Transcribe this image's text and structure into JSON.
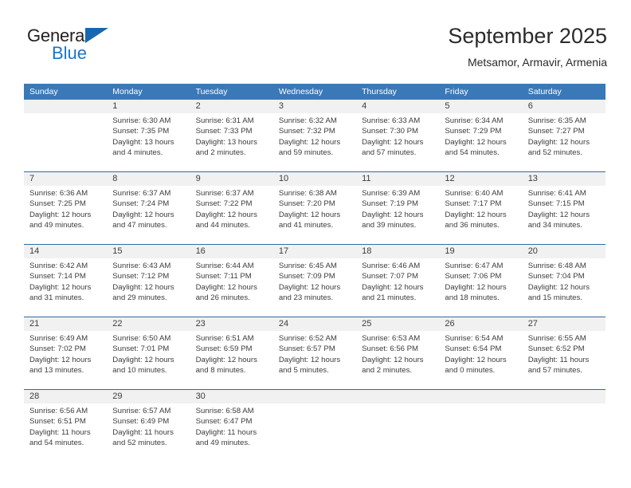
{
  "logo": {
    "word_one": "General",
    "word_two": "Blue",
    "triangle_color": "#1667b2",
    "blue_color": "#1a75c7"
  },
  "header": {
    "title": "September 2025",
    "subtitle": "Metsamor, Armavir, Armenia"
  },
  "theme": {
    "header_blue": "#3a79b8",
    "separator_blue": "#2d6ca8",
    "date_strip_gray": "#f1f1f1",
    "text_color": "#3c3c3c"
  },
  "weekdays": [
    "Sunday",
    "Monday",
    "Tuesday",
    "Wednesday",
    "Thursday",
    "Friday",
    "Saturday"
  ],
  "weeks": [
    {
      "days": [
        {
          "num": "",
          "sunrise": "",
          "sunset": "",
          "daylight1": "",
          "daylight2": "",
          "blank": true
        },
        {
          "num": "1",
          "sunrise": "Sunrise: 6:30 AM",
          "sunset": "Sunset: 7:35 PM",
          "daylight1": "Daylight: 13 hours",
          "daylight2": "and 4 minutes."
        },
        {
          "num": "2",
          "sunrise": "Sunrise: 6:31 AM",
          "sunset": "Sunset: 7:33 PM",
          "daylight1": "Daylight: 13 hours",
          "daylight2": "and 2 minutes."
        },
        {
          "num": "3",
          "sunrise": "Sunrise: 6:32 AM",
          "sunset": "Sunset: 7:32 PM",
          "daylight1": "Daylight: 12 hours",
          "daylight2": "and 59 minutes."
        },
        {
          "num": "4",
          "sunrise": "Sunrise: 6:33 AM",
          "sunset": "Sunset: 7:30 PM",
          "daylight1": "Daylight: 12 hours",
          "daylight2": "and 57 minutes."
        },
        {
          "num": "5",
          "sunrise": "Sunrise: 6:34 AM",
          "sunset": "Sunset: 7:29 PM",
          "daylight1": "Daylight: 12 hours",
          "daylight2": "and 54 minutes."
        },
        {
          "num": "6",
          "sunrise": "Sunrise: 6:35 AM",
          "sunset": "Sunset: 7:27 PM",
          "daylight1": "Daylight: 12 hours",
          "daylight2": "and 52 minutes."
        }
      ]
    },
    {
      "days": [
        {
          "num": "7",
          "sunrise": "Sunrise: 6:36 AM",
          "sunset": "Sunset: 7:25 PM",
          "daylight1": "Daylight: 12 hours",
          "daylight2": "and 49 minutes."
        },
        {
          "num": "8",
          "sunrise": "Sunrise: 6:37 AM",
          "sunset": "Sunset: 7:24 PM",
          "daylight1": "Daylight: 12 hours",
          "daylight2": "and 47 minutes."
        },
        {
          "num": "9",
          "sunrise": "Sunrise: 6:37 AM",
          "sunset": "Sunset: 7:22 PM",
          "daylight1": "Daylight: 12 hours",
          "daylight2": "and 44 minutes."
        },
        {
          "num": "10",
          "sunrise": "Sunrise: 6:38 AM",
          "sunset": "Sunset: 7:20 PM",
          "daylight1": "Daylight: 12 hours",
          "daylight2": "and 41 minutes."
        },
        {
          "num": "11",
          "sunrise": "Sunrise: 6:39 AM",
          "sunset": "Sunset: 7:19 PM",
          "daylight1": "Daylight: 12 hours",
          "daylight2": "and 39 minutes."
        },
        {
          "num": "12",
          "sunrise": "Sunrise: 6:40 AM",
          "sunset": "Sunset: 7:17 PM",
          "daylight1": "Daylight: 12 hours",
          "daylight2": "and 36 minutes."
        },
        {
          "num": "13",
          "sunrise": "Sunrise: 6:41 AM",
          "sunset": "Sunset: 7:15 PM",
          "daylight1": "Daylight: 12 hours",
          "daylight2": "and 34 minutes."
        }
      ]
    },
    {
      "days": [
        {
          "num": "14",
          "sunrise": "Sunrise: 6:42 AM",
          "sunset": "Sunset: 7:14 PM",
          "daylight1": "Daylight: 12 hours",
          "daylight2": "and 31 minutes."
        },
        {
          "num": "15",
          "sunrise": "Sunrise: 6:43 AM",
          "sunset": "Sunset: 7:12 PM",
          "daylight1": "Daylight: 12 hours",
          "daylight2": "and 29 minutes."
        },
        {
          "num": "16",
          "sunrise": "Sunrise: 6:44 AM",
          "sunset": "Sunset: 7:11 PM",
          "daylight1": "Daylight: 12 hours",
          "daylight2": "and 26 minutes."
        },
        {
          "num": "17",
          "sunrise": "Sunrise: 6:45 AM",
          "sunset": "Sunset: 7:09 PM",
          "daylight1": "Daylight: 12 hours",
          "daylight2": "and 23 minutes."
        },
        {
          "num": "18",
          "sunrise": "Sunrise: 6:46 AM",
          "sunset": "Sunset: 7:07 PM",
          "daylight1": "Daylight: 12 hours",
          "daylight2": "and 21 minutes."
        },
        {
          "num": "19",
          "sunrise": "Sunrise: 6:47 AM",
          "sunset": "Sunset: 7:06 PM",
          "daylight1": "Daylight: 12 hours",
          "daylight2": "and 18 minutes."
        },
        {
          "num": "20",
          "sunrise": "Sunrise: 6:48 AM",
          "sunset": "Sunset: 7:04 PM",
          "daylight1": "Daylight: 12 hours",
          "daylight2": "and 15 minutes."
        }
      ]
    },
    {
      "days": [
        {
          "num": "21",
          "sunrise": "Sunrise: 6:49 AM",
          "sunset": "Sunset: 7:02 PM",
          "daylight1": "Daylight: 12 hours",
          "daylight2": "and 13 minutes."
        },
        {
          "num": "22",
          "sunrise": "Sunrise: 6:50 AM",
          "sunset": "Sunset: 7:01 PM",
          "daylight1": "Daylight: 12 hours",
          "daylight2": "and 10 minutes."
        },
        {
          "num": "23",
          "sunrise": "Sunrise: 6:51 AM",
          "sunset": "Sunset: 6:59 PM",
          "daylight1": "Daylight: 12 hours",
          "daylight2": "and 8 minutes."
        },
        {
          "num": "24",
          "sunrise": "Sunrise: 6:52 AM",
          "sunset": "Sunset: 6:57 PM",
          "daylight1": "Daylight: 12 hours",
          "daylight2": "and 5 minutes."
        },
        {
          "num": "25",
          "sunrise": "Sunrise: 6:53 AM",
          "sunset": "Sunset: 6:56 PM",
          "daylight1": "Daylight: 12 hours",
          "daylight2": "and 2 minutes."
        },
        {
          "num": "26",
          "sunrise": "Sunrise: 6:54 AM",
          "sunset": "Sunset: 6:54 PM",
          "daylight1": "Daylight: 12 hours",
          "daylight2": "and 0 minutes."
        },
        {
          "num": "27",
          "sunrise": "Sunrise: 6:55 AM",
          "sunset": "Sunset: 6:52 PM",
          "daylight1": "Daylight: 11 hours",
          "daylight2": "and 57 minutes."
        }
      ]
    },
    {
      "days": [
        {
          "num": "28",
          "sunrise": "Sunrise: 6:56 AM",
          "sunset": "Sunset: 6:51 PM",
          "daylight1": "Daylight: 11 hours",
          "daylight2": "and 54 minutes."
        },
        {
          "num": "29",
          "sunrise": "Sunrise: 6:57 AM",
          "sunset": "Sunset: 6:49 PM",
          "daylight1": "Daylight: 11 hours",
          "daylight2": "and 52 minutes."
        },
        {
          "num": "30",
          "sunrise": "Sunrise: 6:58 AM",
          "sunset": "Sunset: 6:47 PM",
          "daylight1": "Daylight: 11 hours",
          "daylight2": "and 49 minutes."
        },
        {
          "num": "",
          "sunrise": "",
          "sunset": "",
          "daylight1": "",
          "daylight2": "",
          "blank": true
        },
        {
          "num": "",
          "sunrise": "",
          "sunset": "",
          "daylight1": "",
          "daylight2": "",
          "blank": true
        },
        {
          "num": "",
          "sunrise": "",
          "sunset": "",
          "daylight1": "",
          "daylight2": "",
          "blank": true
        },
        {
          "num": "",
          "sunrise": "",
          "sunset": "",
          "daylight1": "",
          "daylight2": "",
          "blank": true
        }
      ]
    }
  ]
}
